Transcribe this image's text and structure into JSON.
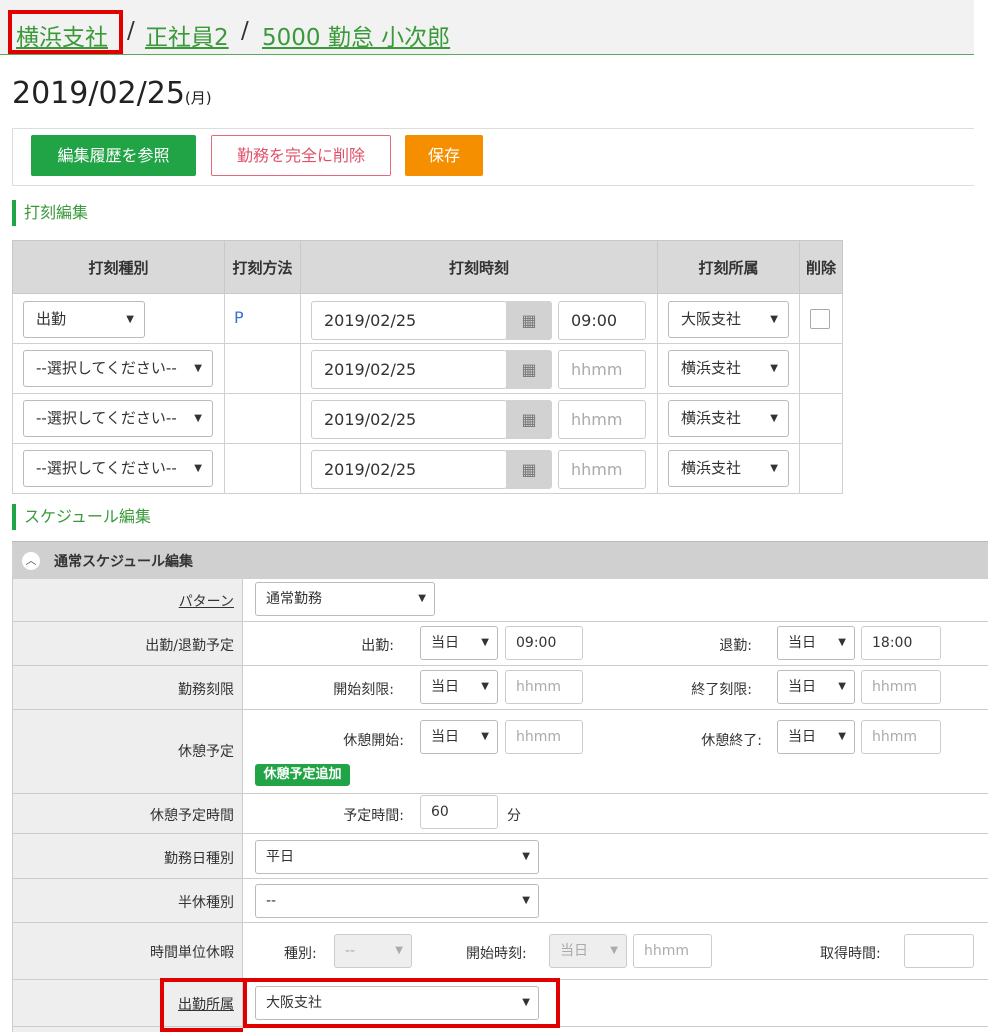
{
  "breadcrumb": {
    "items": [
      "横浜支社",
      "正社員2",
      "5000 勤怠 小次郎"
    ],
    "separator": "/"
  },
  "date": {
    "value": "2019/02/25",
    "weekday": "(月)"
  },
  "actions": {
    "history": "編集履歴を参照",
    "delete_all": "勤務を完全に削除",
    "save": "保存"
  },
  "punch_section": {
    "title": "打刻編集",
    "headers": [
      "打刻種別",
      "打刻方法",
      "打刻時刻",
      "打刻所属",
      "削除"
    ],
    "rows": [
      {
        "type": "出勤",
        "method": "P",
        "date": "2019/02/25",
        "time": "09:00",
        "time_placeholder": "",
        "org": "大阪支社",
        "has_delete": true
      },
      {
        "type": "--選択してください--",
        "method": "",
        "date": "2019/02/25",
        "time": "",
        "time_placeholder": "hhmm",
        "org": "横浜支社",
        "has_delete": false
      },
      {
        "type": "--選択してください--",
        "method": "",
        "date": "2019/02/25",
        "time": "",
        "time_placeholder": "hhmm",
        "org": "横浜支社",
        "has_delete": false
      },
      {
        "type": "--選択してください--",
        "method": "",
        "date": "2019/02/25",
        "time": "",
        "time_placeholder": "hhmm",
        "org": "横浜支社",
        "has_delete": false
      }
    ]
  },
  "schedule_section": {
    "title": "スケジュール編集",
    "subsection": "通常スケジュール編集",
    "pattern": {
      "label": "パターン",
      "value": "通常勤務"
    },
    "work_plan": {
      "label": "出勤/退勤予定",
      "start_label": "出勤:",
      "start_day": "当日",
      "start_time": "09:00",
      "end_label": "退勤:",
      "end_day": "当日",
      "end_time": "18:00"
    },
    "work_limit": {
      "label": "勤務刻限",
      "start_label": "開始刻限:",
      "start_day": "当日",
      "start_placeholder": "hhmm",
      "end_label": "終了刻限:",
      "end_day": "当日",
      "end_placeholder": "hhmm"
    },
    "break_plan": {
      "label": "休憩予定",
      "start_label": "休憩開始:",
      "start_day": "当日",
      "start_placeholder": "hhmm",
      "end_label": "休憩終了:",
      "end_day": "当日",
      "end_placeholder": "hhmm",
      "add_button": "休憩予定追加"
    },
    "break_time": {
      "label": "休憩予定時間",
      "field_label": "予定時間:",
      "value": "60",
      "unit": "分"
    },
    "day_type": {
      "label": "勤務日種別",
      "value": "平日"
    },
    "half_leave": {
      "label": "半休種別",
      "value": "--"
    },
    "hourly_leave": {
      "label": "時間単位休暇",
      "type_label": "種別:",
      "type_value": "--",
      "start_label": "開始時刻:",
      "start_day": "当日",
      "start_placeholder": "hhmm",
      "duration_label": "取得時間:"
    },
    "work_org": {
      "label": "出勤所属",
      "value": "大阪支社"
    }
  },
  "colors": {
    "accent_green": "#21a446",
    "orange": "#f68f00",
    "highlight_red": "#e00000"
  },
  "icons": {
    "calendar": "calendar-icon",
    "caret": "caret-down-icon",
    "collapse": "chevron-up-icon"
  }
}
